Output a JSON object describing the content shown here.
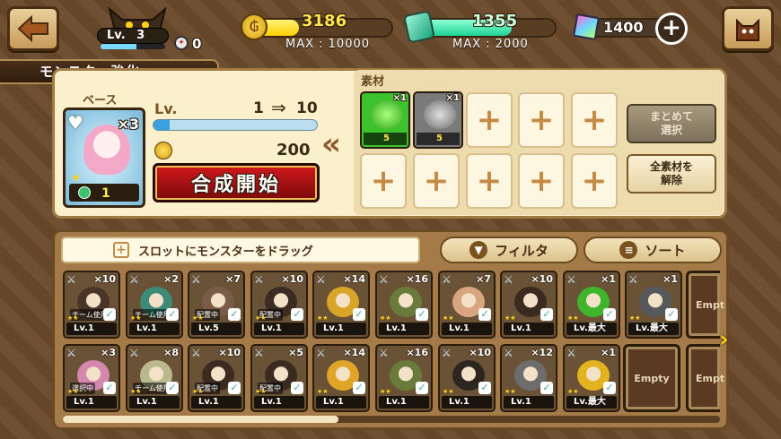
{
  "player": {
    "level_label": "Lv.",
    "level": "3",
    "bomb_count": "0"
  },
  "resources": {
    "gold": {
      "value": "3186",
      "max_label": "MAX : 10000",
      "fill": 0.32
    },
    "stones": {
      "value": "1355",
      "max_label": "MAX : 2000",
      "fill": 0.68
    },
    "gems": {
      "value": "1400"
    }
  },
  "screen_title": "モンスター強化",
  "base": {
    "label": "ベース",
    "count": "×3",
    "rank": "1",
    "level_label": "Lv.",
    "level_from": "1",
    "arrow": "⇒",
    "level_to": "10",
    "level_fill": 0.1,
    "cost": "200",
    "start_button": "合成開始"
  },
  "materials": {
    "label": "素材",
    "slots": [
      {
        "count": "×1",
        "rank": "5"
      },
      {
        "count": "×1",
        "rank": "5"
      }
    ],
    "empty_slot_count": 8
  },
  "side_buttons": {
    "bulk_select": "まとめて\n選択",
    "clear_all": "全素材を\n解除"
  },
  "toolbar": {
    "drag_hint": "スロットにモンスターをドラッグ",
    "filter": "フィルタ",
    "sort": "ソート"
  },
  "grid": [
    [
      {
        "c": "×10",
        "b": "チーム使用中",
        "l": "Lv.1",
        "col": "#4b3528"
      },
      {
        "c": "×2",
        "b": "チーム使用中",
        "l": "Lv.1",
        "col": "#3d8a78"
      },
      {
        "c": "×7",
        "b": "配置中",
        "l": "Lv.5",
        "col": "#7a5d48"
      },
      {
        "c": "×10",
        "b": "配置中",
        "l": "Lv.1",
        "col": "#3a2c22"
      },
      {
        "c": "×14",
        "b": "",
        "l": "Lv.1",
        "col": "#d8a527"
      },
      {
        "c": "×16",
        "b": "",
        "l": "Lv.1",
        "col": "#6a7a3a"
      },
      {
        "c": "×7",
        "b": "",
        "l": "Lv.1",
        "col": "#d9a580"
      },
      {
        "c": "×10",
        "b": "",
        "l": "Lv.1",
        "col": "#3a2a20"
      },
      {
        "c": "×1",
        "b": "",
        "l": "Lv.最大",
        "col": "#3fb52b"
      },
      {
        "c": "×1",
        "b": "",
        "l": "Lv.最大",
        "col": "#55595c"
      }
    ],
    [
      {
        "c": "×3",
        "b": "選択中",
        "l": "Lv.1",
        "col": "#d488b0"
      },
      {
        "c": "×8",
        "b": "チーム使用中",
        "l": "Lv.1",
        "col": "#b9b98d"
      },
      {
        "c": "×10",
        "b": "配置中",
        "l": "Lv.1",
        "col": "#3a2a20"
      },
      {
        "c": "×5",
        "b": "配置中",
        "l": "Lv.1",
        "col": "#3a2a20"
      },
      {
        "c": "×14",
        "b": "",
        "l": "Lv.1",
        "col": "#e0a526"
      },
      {
        "c": "×16",
        "b": "",
        "l": "Lv.1",
        "col": "#6a7a3a"
      },
      {
        "c": "×10",
        "b": "",
        "l": "Lv.1",
        "col": "#2d2520"
      },
      {
        "c": "×12",
        "b": "",
        "l": "Lv.1",
        "col": "#6d6d6d"
      },
      {
        "c": "×1",
        "b": "",
        "l": "Lv.最大",
        "col": "#e2b31e"
      }
    ]
  ],
  "empty_label": "Empty",
  "empty_partial": "Empt"
}
